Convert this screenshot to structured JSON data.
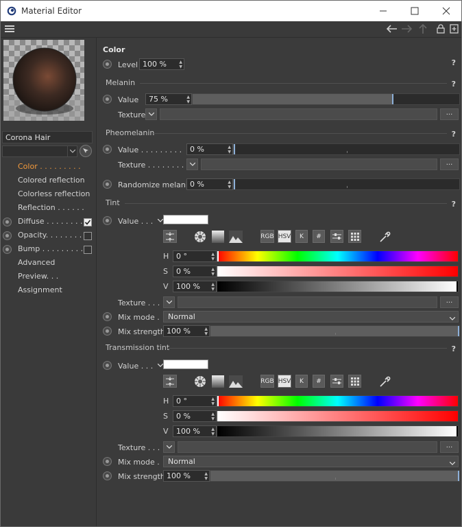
{
  "window": {
    "title": "Material Editor"
  },
  "material": {
    "name": "Corona Hair"
  },
  "nav": [
    {
      "label": "Color . . . . . . . . .",
      "active": true,
      "radio": false,
      "checkbox": null
    },
    {
      "label": "Colored reflection",
      "active": false,
      "radio": false,
      "checkbox": null
    },
    {
      "label": "Colorless reflection",
      "active": false,
      "radio": false,
      "checkbox": null
    },
    {
      "label": "Reflection . . . . . .",
      "active": false,
      "radio": false,
      "checkbox": null
    },
    {
      "label": "Diffuse . . . . . . . .",
      "active": false,
      "radio": true,
      "checkbox": true
    },
    {
      "label": "Opacity. . . . . . . .",
      "active": false,
      "radio": true,
      "checkbox": false
    },
    {
      "label": "Bump . . . . . . . . .",
      "active": false,
      "radio": true,
      "checkbox": false
    },
    {
      "label": "Advanced",
      "active": false,
      "radio": false,
      "checkbox": null
    },
    {
      "label": "Preview. . .",
      "active": false,
      "radio": false,
      "checkbox": null
    },
    {
      "label": "Assignment",
      "active": false,
      "radio": false,
      "checkbox": null
    }
  ],
  "color": {
    "heading": "Color",
    "level_label": "Level",
    "level_value": "100 %",
    "help": "?"
  },
  "melanin": {
    "heading": "Melanin",
    "help": "?",
    "value_label": "Value",
    "value": "75 %",
    "value_fraction": 0.75,
    "texture_label": "Texture",
    "dots": "..."
  },
  "pheomelanin": {
    "heading": "Pheomelanin",
    "help": "?",
    "value_label": "Value . . . . . . . . .",
    "value": "0 %",
    "value_fraction": 0.0,
    "texture_label": "Texture . . . . . . . .",
    "dots": "...",
    "randomize_label": "Randomize melanin",
    "randomize_value": "0 %",
    "randomize_fraction": 0.0
  },
  "tint": {
    "heading": "Tint",
    "help": "?",
    "value_label": "Value . . .",
    "swatch_color": "#ffffff",
    "mode_buttons": [
      "RGB",
      "HSV",
      "K",
      "#"
    ],
    "selected_mode": "HSV",
    "h_label": "H",
    "h_value": "0 °",
    "s_label": "S",
    "s_value": "0 %",
    "v_label": "V",
    "v_value": "100 %",
    "texture_label": "Texture . . .",
    "dots": "...",
    "mix_mode_label": "Mix mode .",
    "mix_mode_value": "Normal",
    "mix_strength_label": "Mix strength",
    "mix_strength_value": "100 %",
    "mix_strength_fraction": 1.0
  },
  "transmission_tint": {
    "heading": "Transmission tint",
    "help": "?",
    "value_label": "Value . . .",
    "swatch_color": "#ffffff",
    "mode_buttons": [
      "RGB",
      "HSV",
      "K",
      "#"
    ],
    "selected_mode": "HSV",
    "h_label": "H",
    "h_value": "0 °",
    "s_label": "S",
    "s_value": "0 %",
    "v_label": "V",
    "v_value": "100 %",
    "texture_label": "Texture . . .",
    "dots": "...",
    "mix_mode_label": "Mix mode .",
    "mix_mode_value": "Normal",
    "mix_strength_label": "Mix strength",
    "mix_strength_value": "100 %",
    "mix_strength_fraction": 1.0
  },
  "colors": {
    "active_nav": "#f39a3c",
    "slider_knob": "#8db0d8"
  }
}
